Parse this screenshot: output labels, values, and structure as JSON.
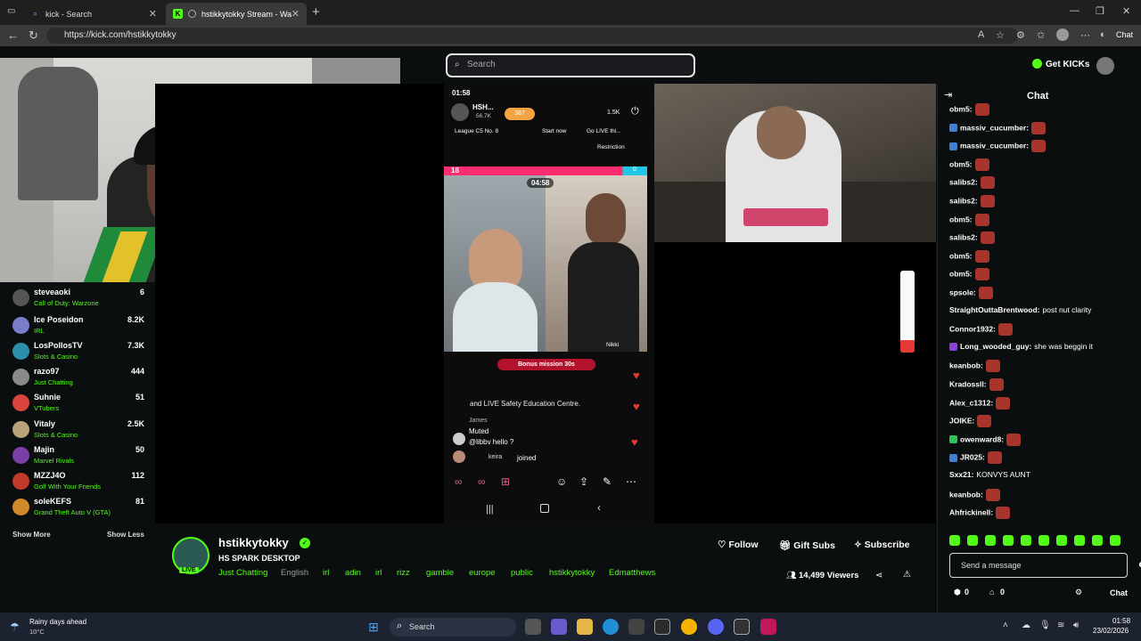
{
  "browser": {
    "tabs": [
      {
        "label": "kick - Search",
        "icon": "search-icon"
      },
      {
        "label": "hstikkytokky Stream - Watch",
        "icon": "kick-logo-icon"
      }
    ],
    "url": "https://kick.com/hstikkytokky",
    "chat_label": "Chat"
  },
  "header": {
    "search_placeholder": "Search",
    "get_kicks": "Get KICKs"
  },
  "sidebar": {
    "channels": [
      {
        "name": "steveaoki",
        "category": "Call of Duty: Warzone",
        "viewers": "6"
      },
      {
        "name": "Ice Poseidon",
        "category": "IRL",
        "viewers": "8.2K"
      },
      {
        "name": "LosPollosTV",
        "category": "Slots & Casino",
        "viewers": "7.3K"
      },
      {
        "name": "razo97",
        "category": "Just Chatting",
        "viewers": "444"
      },
      {
        "name": "Suhnie",
        "category": "VTubers",
        "viewers": "51"
      },
      {
        "name": "Vitaly",
        "category": "Slots & Casino",
        "viewers": "2.5K"
      },
      {
        "name": "Majin",
        "category": "Marvel Rivals",
        "viewers": "50"
      },
      {
        "name": "MZZJ4O",
        "category": "Golf With Your Friends",
        "viewers": "112"
      },
      {
        "name": "soleKEFS",
        "category": "Grand Theft Auto V (GTA)",
        "viewers": "81"
      }
    ],
    "show_more": "Show More",
    "show_less": "Show Less"
  },
  "video": {
    "phone_time": "01:58",
    "host_name": "HSH...",
    "host_followers": "56.7K",
    "coins": "387",
    "viewers_small": "1.5K",
    "league": "League C5 No. 8",
    "start_now": "Start now",
    "go_live": "Go LIVE thi...",
    "restriction": "Restriction",
    "battle_score_left": "18",
    "battle_score_right": "0",
    "timer": "04:58",
    "bonus": "Bonus mission 30s",
    "safety_text": "and LIVE Safety Education Centre.",
    "user_james": "James",
    "muted": "Muted",
    "hello": "@libbv hello ?",
    "joined_user": "keira",
    "joined": "joined",
    "nikki": "Nikki"
  },
  "chat": {
    "title": "Chat",
    "messages": [
      {
        "user": "obm5:",
        "text": "",
        "emote": true,
        "badge": ""
      },
      {
        "user": "massiv_cucumber:",
        "text": "",
        "emote": true,
        "badge": "blue"
      },
      {
        "user": "massiv_cucumber:",
        "text": "",
        "emote": true,
        "badge": "blue"
      },
      {
        "user": "obm5:",
        "text": "",
        "emote": true,
        "badge": ""
      },
      {
        "user": "salibs2:",
        "text": "",
        "emote": true,
        "badge": ""
      },
      {
        "user": "salibs2:",
        "text": "",
        "emote": true,
        "badge": ""
      },
      {
        "user": "obm5:",
        "text": "",
        "emote": true,
        "badge": ""
      },
      {
        "user": "salibs2:",
        "text": "",
        "emote": true,
        "badge": ""
      },
      {
        "user": "obm5:",
        "text": "",
        "emote": true,
        "badge": ""
      },
      {
        "user": "obm5:",
        "text": "",
        "emote": true,
        "badge": ""
      },
      {
        "user": "spsole:",
        "text": "",
        "emote": true,
        "badge": ""
      },
      {
        "user": "StraightOuttaBrentwood:",
        "text": "post nut clarity",
        "emote": false,
        "badge": ""
      },
      {
        "user": "Connor1932:",
        "text": "",
        "emote": true,
        "badge": ""
      },
      {
        "user": "Long_wooded_guy:",
        "text": "she was beggin it",
        "emote": false,
        "badge": "purple"
      },
      {
        "user": "keanbob:",
        "text": "",
        "emote": true,
        "badge": ""
      },
      {
        "user": "Kradossll:",
        "text": "",
        "emote": true,
        "badge": ""
      },
      {
        "user": "Alex_c1312:",
        "text": "",
        "emote": true,
        "badge": ""
      },
      {
        "user": "JOIKE:",
        "text": "",
        "emote": true,
        "badge": ""
      },
      {
        "user": "owenward8:",
        "text": "",
        "emote": true,
        "badge": "green"
      },
      {
        "user": "JR025:",
        "text": "",
        "emote": true,
        "badge": "blue"
      },
      {
        "user": "Sxx21:",
        "text": "KONVYS AUNT",
        "emote": false,
        "badge": ""
      },
      {
        "user": "keanbob:",
        "text": "",
        "emote": true,
        "badge": ""
      },
      {
        "user": "Ahfrickinell:",
        "text": "",
        "emote": true,
        "badge": ""
      }
    ],
    "send_placeholder": "Send a message",
    "count_a": "0",
    "count_b": "0",
    "chat_button": "Chat"
  },
  "channel": {
    "name": "hstikkytokky",
    "title": "HS SPARK DESKTOP",
    "live": "LIVE",
    "category": "Just Chatting",
    "language": "English",
    "tags": [
      "irl",
      "adin",
      "irl",
      "rizz",
      "gamble",
      "europe",
      "public",
      "hstikkytokky",
      "Edmatthews"
    ],
    "follow": "Follow",
    "gift_subs": "Gift Subs",
    "subscribe": "Subscribe",
    "viewers": "14,499 Viewers"
  },
  "taskbar": {
    "weather_title": "Rainy days ahead",
    "weather_temp": "10°C",
    "search": "Search",
    "time": "01:58",
    "date": "23/02/2026"
  },
  "colors": {
    "kick_green": "#53fc18",
    "background": "#0b0e0f",
    "verified_green": "#53fc18"
  }
}
